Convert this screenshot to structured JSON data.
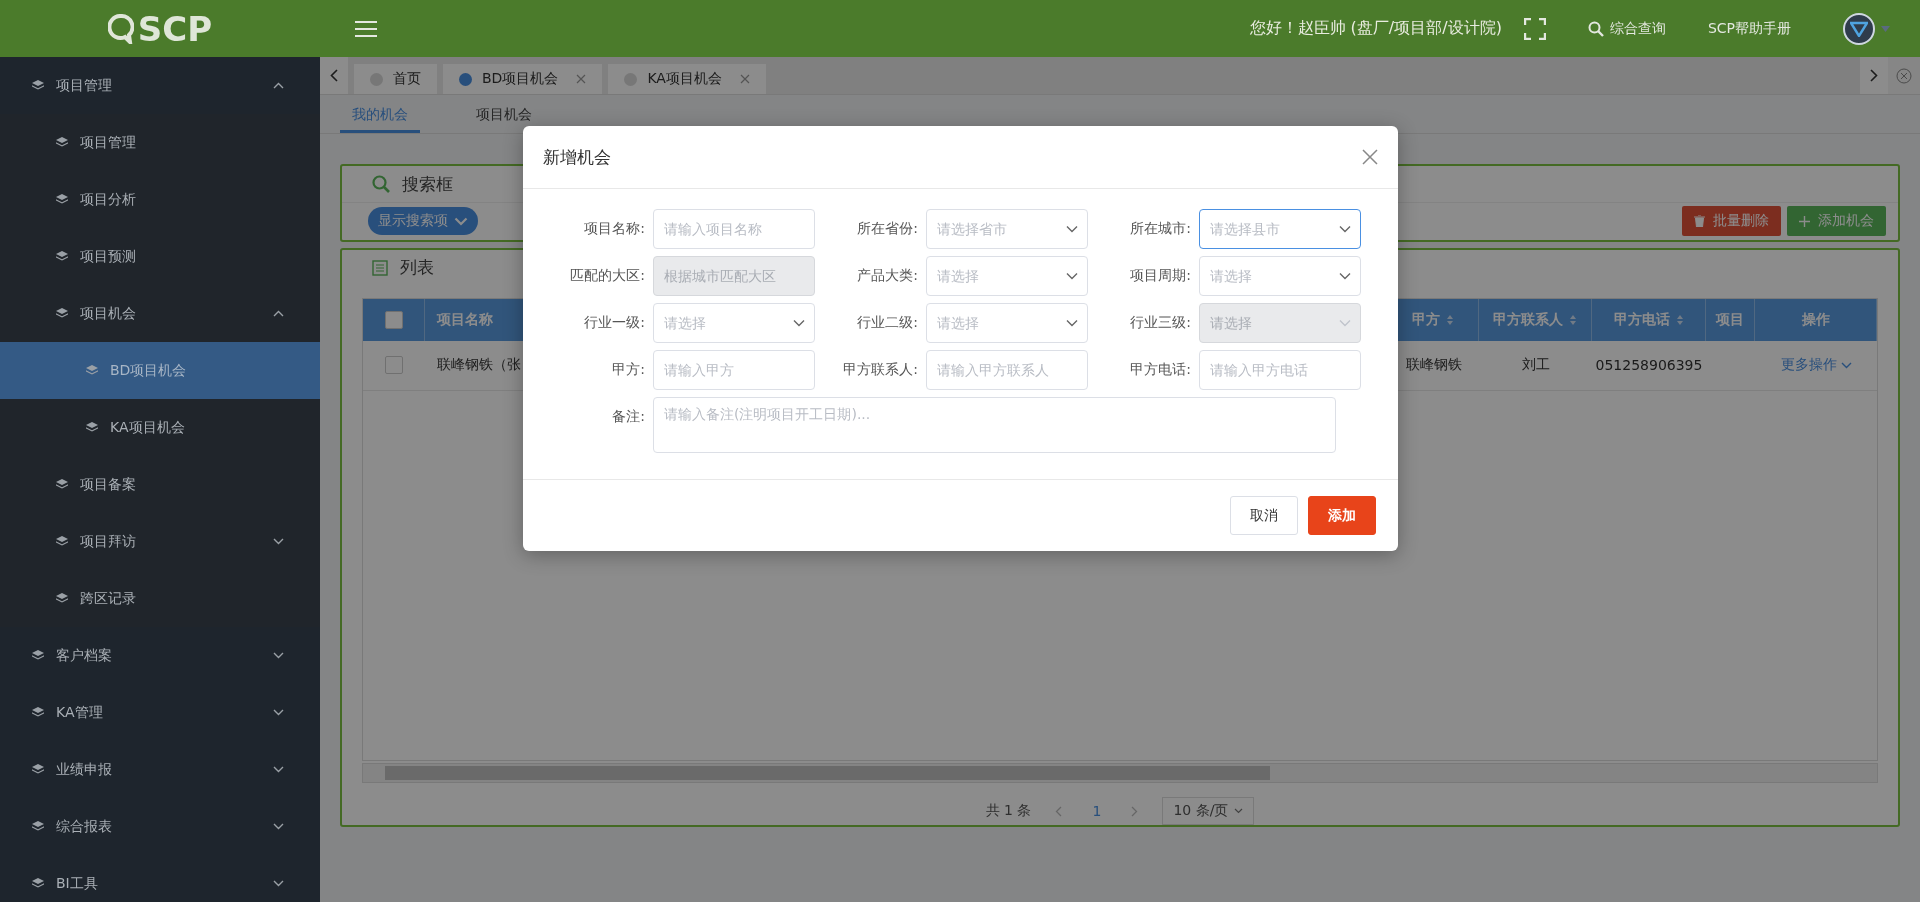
{
  "header": {
    "logo": "SCP",
    "greeting": "您好！赵臣帅 (盘厂/项目部/设计院)",
    "search_link": "综合查询",
    "help_link": "SCP帮助手册"
  },
  "sidebar": {
    "items": [
      {
        "label": "项目管理",
        "expanded": true,
        "selected": false,
        "children": [
          {
            "label": "项目管理",
            "selected": false
          },
          {
            "label": "项目分析",
            "selected": false
          },
          {
            "label": "项目预测",
            "selected": false
          },
          {
            "label": "项目机会",
            "expanded": true,
            "selected": false,
            "children": [
              {
                "label": "BD项目机会",
                "selected": true
              },
              {
                "label": "KA项目机会",
                "selected": false
              }
            ]
          },
          {
            "label": "项目备案",
            "selected": false
          },
          {
            "label": "项目拜访",
            "expanded": false,
            "selected": false
          },
          {
            "label": "跨区记录",
            "selected": false
          }
        ]
      },
      {
        "label": "客户档案",
        "expanded": false,
        "selected": false
      },
      {
        "label": "KA管理",
        "expanded": false,
        "selected": false
      },
      {
        "label": "业绩申报",
        "expanded": false,
        "selected": false
      },
      {
        "label": "综合报表",
        "expanded": false,
        "selected": false
      },
      {
        "label": "BI工具",
        "expanded": false,
        "selected": false
      }
    ]
  },
  "tabs": [
    {
      "label": "首页",
      "selected": false,
      "closable": false
    },
    {
      "label": "BD项目机会",
      "selected": true,
      "closable": true
    },
    {
      "label": "KA项目机会",
      "selected": false,
      "closable": true
    }
  ],
  "subtabs": [
    {
      "label": "我的机会",
      "selected": true
    },
    {
      "label": "项目机会",
      "selected": false
    }
  ],
  "search_panel": {
    "title": "搜索框",
    "toggle": "显示搜索项",
    "buttons": [
      {
        "label": "批量删除",
        "kind": "danger"
      },
      {
        "label": "添加机会",
        "kind": "primary"
      }
    ]
  },
  "list_panel": {
    "title": "列表",
    "table": {
      "select_all": {
        "checked": false
      },
      "columns": [
        {
          "label": "项目名称",
          "kind": "text",
          "sortable": false
        },
        {
          "label": "甲方",
          "kind": "text",
          "sortable": true
        },
        {
          "label": "甲方联系人",
          "kind": "text",
          "sortable": true
        },
        {
          "label": "甲方电话",
          "kind": "text",
          "sortable": true
        },
        {
          "label": "项目",
          "kind": "text",
          "sortable": false
        },
        {
          "label": "操作",
          "kind": "action",
          "sortable": false
        }
      ],
      "rows": [
        {
          "checked": false,
          "cells": [
            "联峰钢铁（张",
            "联峰钢铁",
            "刘工",
            "051258906395",
            "",
            "更多操作"
          ]
        }
      ]
    },
    "pagination": {
      "total": "共 1 条",
      "pages": [
        {
          "label": "1",
          "selected": true
        }
      ],
      "page_size": "10 条/页"
    }
  },
  "dialog": {
    "title": "新增机会",
    "fields": [
      {
        "label": "项目名称:",
        "kind": "text",
        "placeholder": "请输入项目名称",
        "disabled": false,
        "focused": false
      },
      {
        "label": "所在省份:",
        "kind": "select",
        "placeholder": "请选择省市",
        "disabled": false,
        "focused": false
      },
      {
        "label": "所在城市:",
        "kind": "select",
        "placeholder": "请选择县市",
        "disabled": false,
        "focused": true
      },
      {
        "label": "匹配的大区:",
        "kind": "text",
        "placeholder": "根据城市匹配大区",
        "disabled": true,
        "focused": false
      },
      {
        "label": "产品大类:",
        "kind": "select",
        "placeholder": "请选择",
        "disabled": false,
        "focused": false
      },
      {
        "label": "项目周期:",
        "kind": "select",
        "placeholder": "请选择",
        "disabled": false,
        "focused": false
      },
      {
        "label": "行业一级:",
        "kind": "select",
        "placeholder": "请选择",
        "disabled": false,
        "focused": false
      },
      {
        "label": "行业二级:",
        "kind": "select",
        "placeholder": "请选择",
        "disabled": false,
        "focused": false
      },
      {
        "label": "行业三级:",
        "kind": "select",
        "placeholder": "请选择",
        "disabled": true,
        "focused": false
      },
      {
        "label": "甲方:",
        "kind": "text",
        "placeholder": "请输入甲方",
        "disabled": false,
        "focused": false
      },
      {
        "label": "甲方联系人:",
        "kind": "text",
        "placeholder": "请输入甲方联系人",
        "disabled": false,
        "focused": false
      },
      {
        "label": "甲方电话:",
        "kind": "text",
        "placeholder": "请输入甲方电话",
        "disabled": false,
        "focused": false
      },
      {
        "label": "备注:",
        "kind": "textarea",
        "placeholder": "请输入备注(注明项目开工日期)...",
        "disabled": false,
        "focused": false
      }
    ],
    "buttons": [
      {
        "label": "取消",
        "kind": "default"
      },
      {
        "label": "添加",
        "kind": "primary"
      }
    ]
  }
}
